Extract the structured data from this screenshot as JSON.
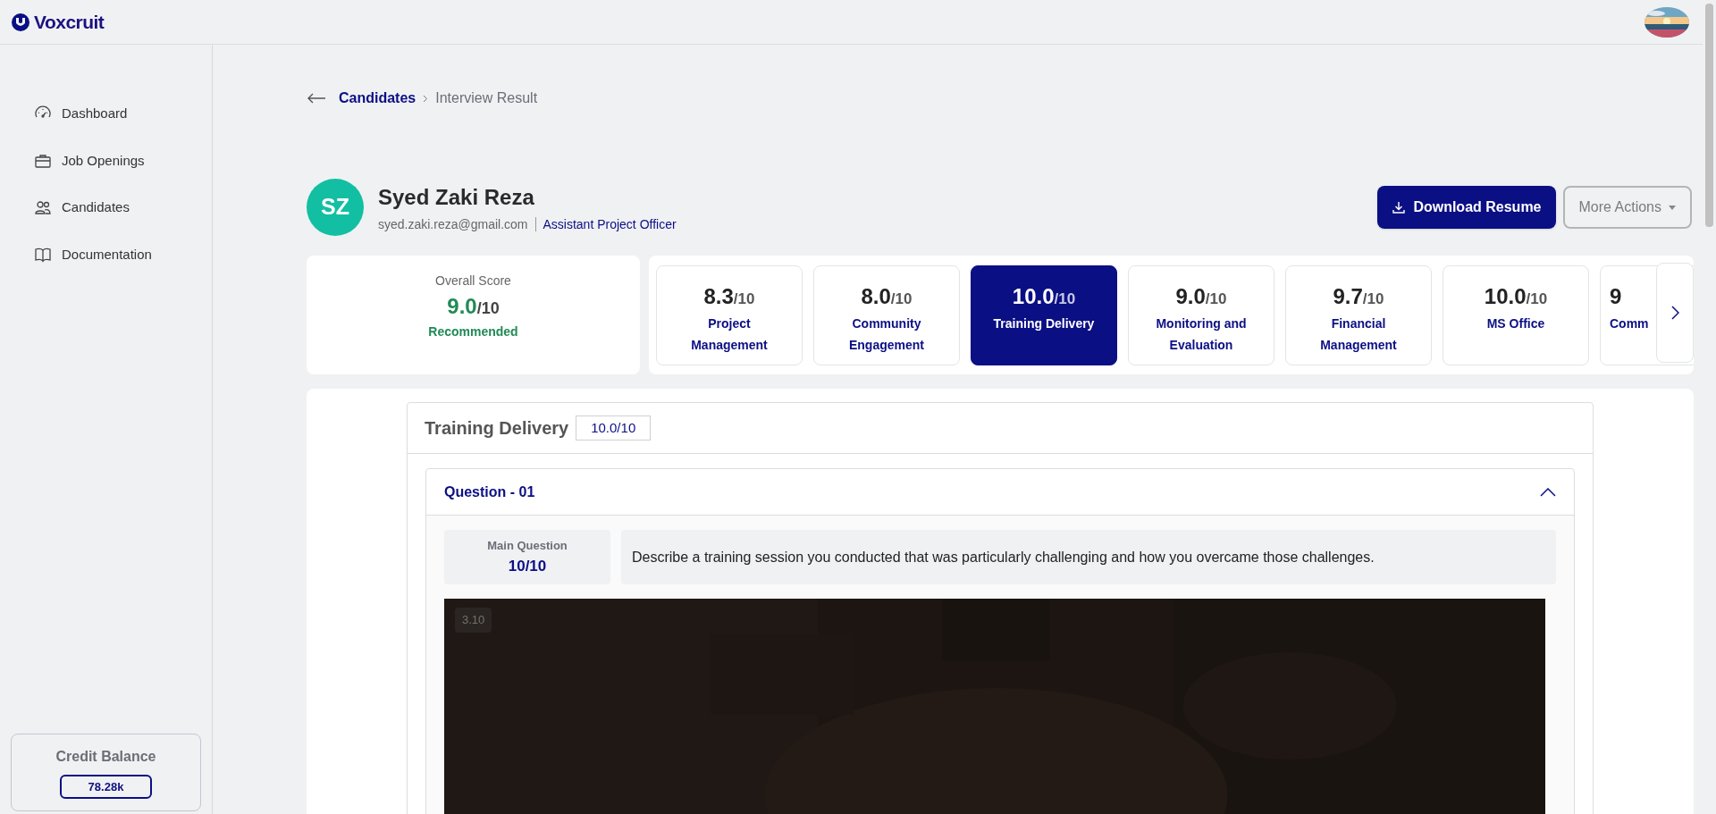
{
  "brand": {
    "name": "Voxcruit"
  },
  "sidebar": {
    "items": [
      {
        "label": "Dashboard"
      },
      {
        "label": "Job Openings"
      },
      {
        "label": "Candidates"
      },
      {
        "label": "Documentation"
      }
    ]
  },
  "credit_balance": {
    "label": "Credit Balance",
    "value": "78.28k"
  },
  "breadcrumb": {
    "parent": "Candidates",
    "current": "Interview Result"
  },
  "candidate": {
    "initials": "SZ",
    "name": "Syed Zaki Reza",
    "email": "syed.zaki.reza@gmail.com",
    "role": "Assistant Project Officer"
  },
  "actions": {
    "primary": "Download Resume",
    "secondary": "More Actions"
  },
  "overall": {
    "label": "Overall Score",
    "score": "9.0",
    "out_of": "/10",
    "verdict": "Recommended"
  },
  "skills": [
    {
      "score": "8.3",
      "out_of": "/10",
      "label": "Project Management",
      "selected": false
    },
    {
      "score": "8.0",
      "out_of": "/10",
      "label": "Community Engagement",
      "selected": false
    },
    {
      "score": "10.0",
      "out_of": "/10",
      "label": "Training Delivery",
      "selected": true
    },
    {
      "score": "9.0",
      "out_of": "/10",
      "label": "Monitoring and Evaluation",
      "selected": false
    },
    {
      "score": "9.7",
      "out_of": "/10",
      "label": "Financial Management",
      "selected": false
    },
    {
      "score": "10.0",
      "out_of": "/10",
      "label": "MS Office",
      "selected": false
    },
    {
      "score": "9",
      "label": "Comm",
      "selected": false
    }
  ],
  "section": {
    "title": "Training Delivery",
    "score": "10.0/10",
    "questions": [
      {
        "title": "Question - 01",
        "expanded": true,
        "score_label": "Main Question",
        "score": "10/10",
        "text": "Describe a training session you conducted that was particularly challenging and how you overcame those challenges.",
        "video": {
          "kind": "picture",
          "badge": "3.10"
        }
      }
    ]
  }
}
